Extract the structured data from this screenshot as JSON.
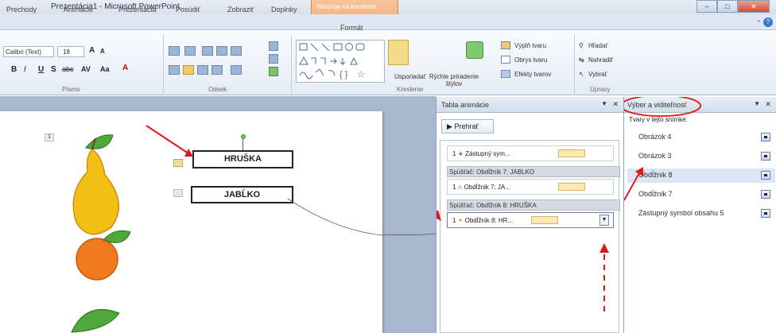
{
  "window": {
    "title": "Prezentácia1 - Microsoft PowerPoint",
    "contextual_tab_group": "Nástroje na kreslenie",
    "min_symbol": "‒",
    "max_symbol": "□",
    "close_symbol": "✕"
  },
  "tabs": [
    "Prechody",
    "Animácie",
    "Prezentácia",
    "Posúdiť",
    "Zobraziť",
    "Doplnky",
    "Formát"
  ],
  "ribbon": {
    "font": {
      "name": "Calibri (Text)",
      "size": "18",
      "group_label": "Písmo",
      "bold": "B",
      "italic": "I",
      "underline": "U",
      "shadow": "S",
      "strike": "abc",
      "spacing": "AV",
      "case": "Aa",
      "color": "A",
      "grow": "A",
      "shrink": "A"
    },
    "paragraph": {
      "group_label": "Odsek"
    },
    "drawing": {
      "group_label": "Kreslenie",
      "arrange": "Usporiadať",
      "quick_styles": "Rýchle priradenie štýlov",
      "shape_fill": "Výplň tvaru",
      "shape_outline": "Obrys tvaru",
      "shape_effects": "Efekty tvarov"
    },
    "editing": {
      "group_label": "Úpravy",
      "find": "Hľadať",
      "replace": "Nahradiť",
      "select": "Vybrať"
    }
  },
  "slide": {
    "number": "1",
    "box1": "HRUŠKA",
    "box2": "JABĹKO"
  },
  "animation_pane": {
    "title": "Tabla animácie",
    "play": "Prehrať",
    "items": [
      {
        "num": "1",
        "label": "Zástupný sym..."
      },
      {
        "trigger": "Spúšťač: Obdĺžnik 7: JABLKO"
      },
      {
        "num": "1",
        "label": "Obdĺžnik 7: JA..."
      },
      {
        "trigger": "Spúšťač: Obdĺžnik 8: HRUŠKA"
      },
      {
        "num": "1",
        "label": "Obdĺžnik 8: HR..."
      }
    ]
  },
  "selection_pane": {
    "title": "Výber a viditeľnosť",
    "subtitle": "Tvary v tejto snímke:",
    "items": [
      "Obrázok 4",
      "Obrázok 3",
      "Obdĺžnik 8",
      "Obdĺžnik 7",
      "Zástupný symbol obsahu 5"
    ]
  },
  "colors": {
    "accent_red": "#e01818",
    "context_orange": "#f4a86e",
    "pear_yellow": "#f2c013",
    "leaf_green": "#4ea83a",
    "peach_orange": "#ef7a20"
  }
}
